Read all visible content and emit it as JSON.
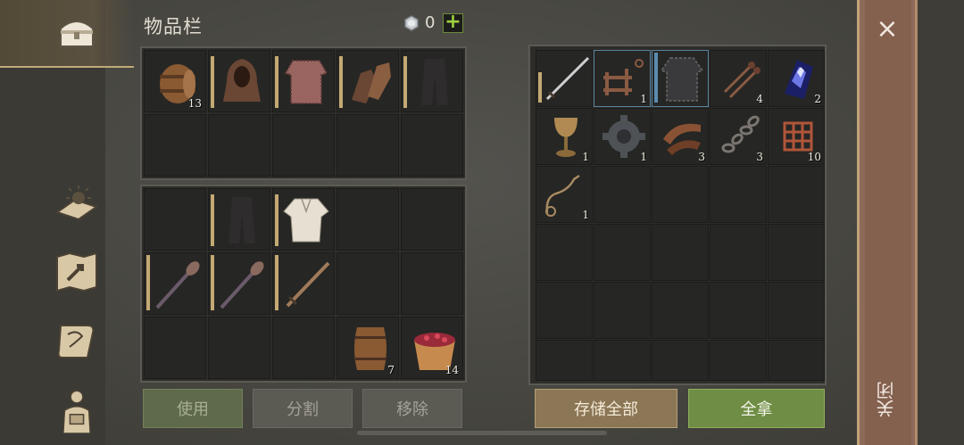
{
  "inventory": {
    "title": "物品栏",
    "gem_count": "0",
    "plus_label": "+",
    "top_slots": [
      {
        "icon": "barrel-icon",
        "qty": "13",
        "bar": false
      },
      {
        "icon": "hood-icon",
        "qty": "",
        "bar": true
      },
      {
        "icon": "chainmail-icon",
        "qty": "",
        "bar": true
      },
      {
        "icon": "gloves-icon",
        "qty": "",
        "bar": true
      },
      {
        "icon": "pants-icon",
        "qty": "",
        "bar": true
      }
    ],
    "bottom_slots": [
      {
        "icon": "pants-icon",
        "qty": "",
        "bar": true
      },
      {
        "icon": "shirt-icon",
        "qty": "",
        "bar": true
      },
      {
        "icon": "mace-icon",
        "qty": "",
        "bar": true
      },
      {
        "icon": "mace-icon",
        "qty": "",
        "bar": true
      },
      {
        "icon": "sword-icon",
        "qty": "",
        "bar": true
      },
      {
        "icon": "small-barrel-icon",
        "qty": "7",
        "bar": false
      },
      {
        "icon": "berry-bucket-icon",
        "qty": "14",
        "bar": false
      }
    ],
    "buttons": {
      "use": "使用",
      "split": "分割",
      "remove": "移除"
    }
  },
  "container": {
    "slots": [
      {
        "icon": "long-sword-icon",
        "qty": "",
        "bar": true,
        "blue": false
      },
      {
        "icon": "rack-icon",
        "qty": "1",
        "bar": false,
        "blue": true
      },
      {
        "icon": "scale-armor-icon",
        "qty": "",
        "bar": true,
        "blue": true
      },
      {
        "icon": "nails-icon",
        "qty": "4",
        "bar": false,
        "blue": false
      },
      {
        "icon": "crystal-icon",
        "qty": "2",
        "bar": false,
        "blue": false
      },
      {
        "icon": "goblet-icon",
        "qty": "1",
        "bar": false,
        "blue": false
      },
      {
        "icon": "gear-icon",
        "qty": "1",
        "bar": false,
        "blue": false
      },
      {
        "icon": "leather-strap-icon",
        "qty": "3",
        "bar": false,
        "blue": false
      },
      {
        "icon": "chain-icon",
        "qty": "3",
        "bar": false,
        "blue": false
      },
      {
        "icon": "rope-net-icon",
        "qty": "10",
        "bar": false,
        "blue": false
      },
      {
        "icon": "rope-icon",
        "qty": "1",
        "bar": false,
        "blue": false
      }
    ],
    "buttons": {
      "store_all": "存储全部",
      "take_all": "全拿"
    }
  },
  "close": {
    "x_label": "×",
    "label": "关闭"
  },
  "colors": {
    "accent_bar": "#c4a974",
    "take_all_green": "#6f8d45",
    "close_strip": "#8e6a5b"
  }
}
